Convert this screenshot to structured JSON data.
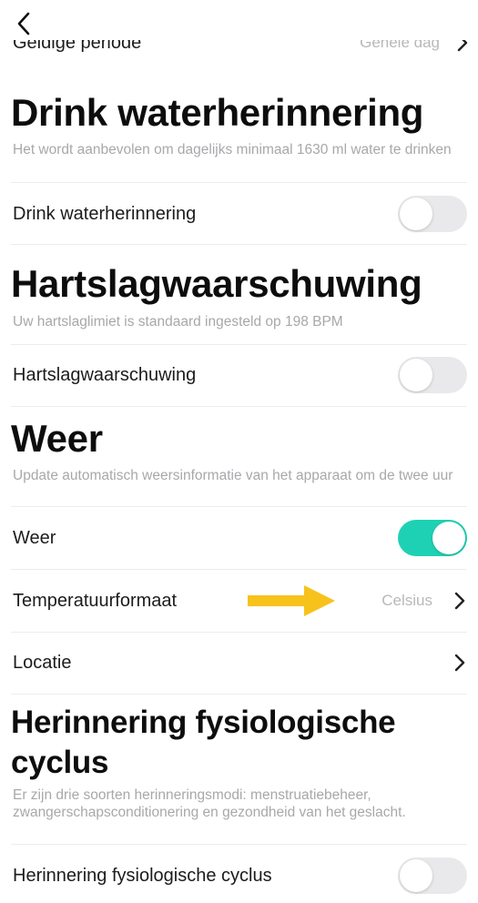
{
  "top_cut": {
    "label": "Geldige periode",
    "value": "Gehele dag"
  },
  "sections": [
    {
      "title": "Drink waterherinnering",
      "description": "Het wordt aanbevolen om dagelijks minimaal 1630 ml water te drinken",
      "rows": [
        {
          "label": "Drink waterherinnering",
          "toggle": "off"
        }
      ]
    },
    {
      "title": "Hartslagwaarschuwing",
      "description": "Uw hartslaglimiet is standaard ingesteld op 198 BPM",
      "rows": [
        {
          "label": "Hartslagwaarschuwing",
          "toggle": "off"
        }
      ]
    },
    {
      "title": "Weer",
      "description": "Update automatisch weersinformatie van het apparaat om de twee uur",
      "rows": [
        {
          "label": "Weer",
          "toggle": "on"
        },
        {
          "label": "Temperatuurformaat",
          "value": "Celsius"
        },
        {
          "label": "Locatie"
        }
      ]
    },
    {
      "title": "Herinnering fysiologische cyclus",
      "description": "Er zijn drie soorten herinneringsmodi: menstruatiebeheer, zwangerschapsconditionering en gezondheid van het geslacht.",
      "rows": [
        {
          "label": "Herinnering fysiologische cyclus",
          "toggle": "off"
        }
      ]
    }
  ],
  "colors": {
    "toggle_on": "#1fd1b4",
    "annotation_arrow": "#f7c21c"
  },
  "icons": {
    "back": "chevron-left-icon",
    "row_chevron": "chevron-right-icon",
    "annotation": "arrow-right-annotation"
  }
}
